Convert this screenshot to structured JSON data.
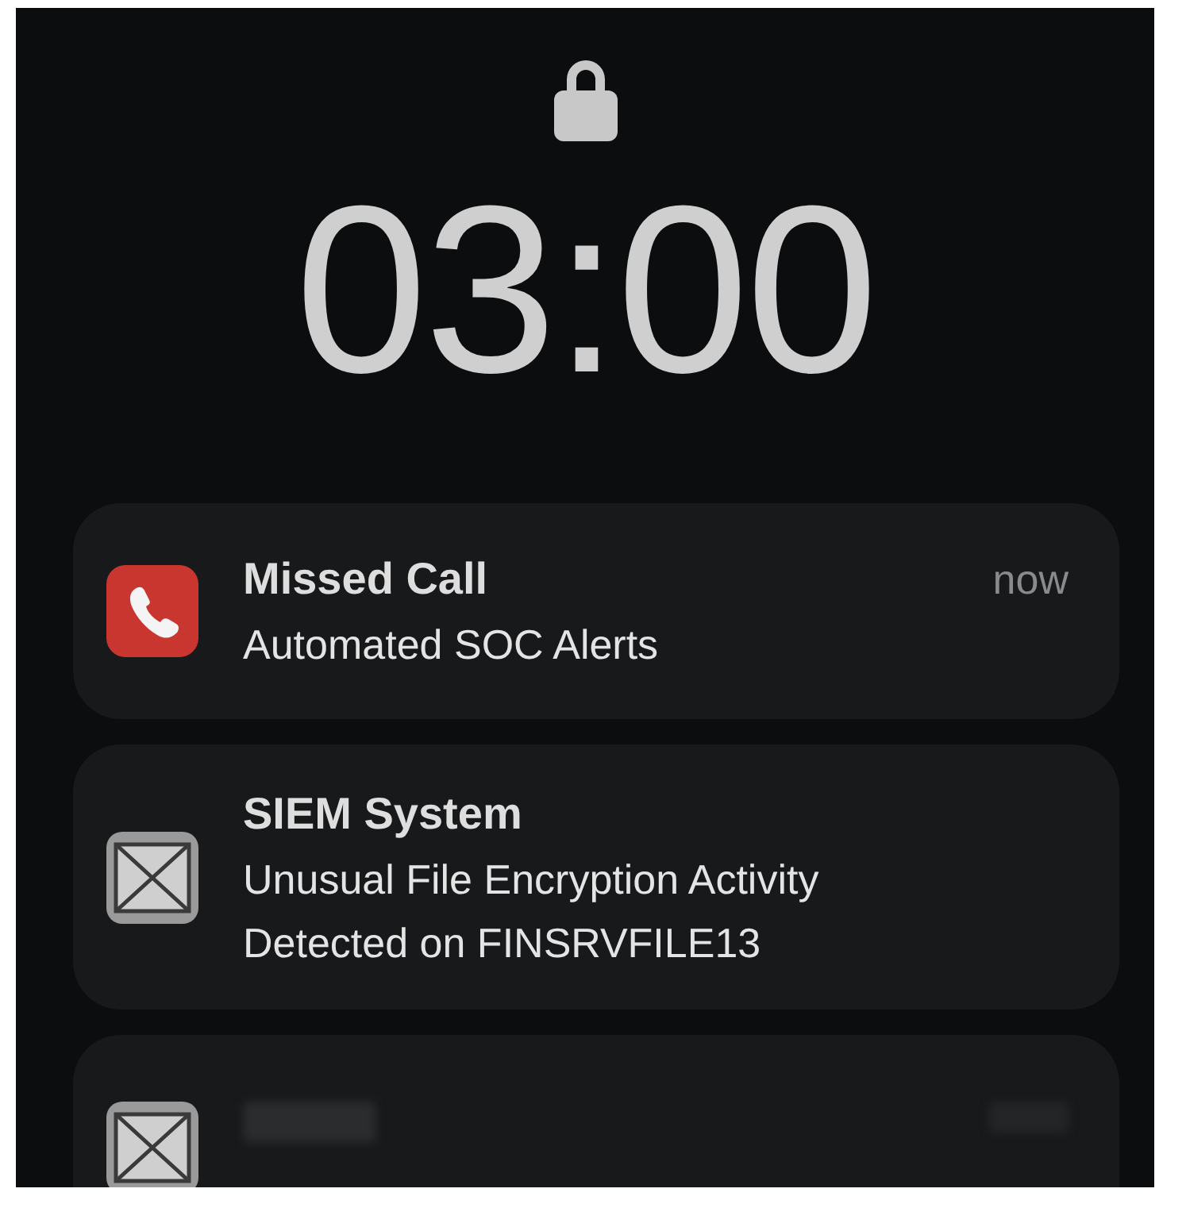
{
  "lock_screen": {
    "time": "03:00"
  },
  "notifications": [
    {
      "kind": "call",
      "title": "Missed Call",
      "time": "now",
      "body": [
        "Automated SOC Alerts"
      ]
    },
    {
      "kind": "mail",
      "title": "SIEM System",
      "body": [
        "Unusual File Encryption Activity",
        "Detected on FINSRVFILE13"
      ]
    },
    {
      "kind": "blurred"
    }
  ]
}
